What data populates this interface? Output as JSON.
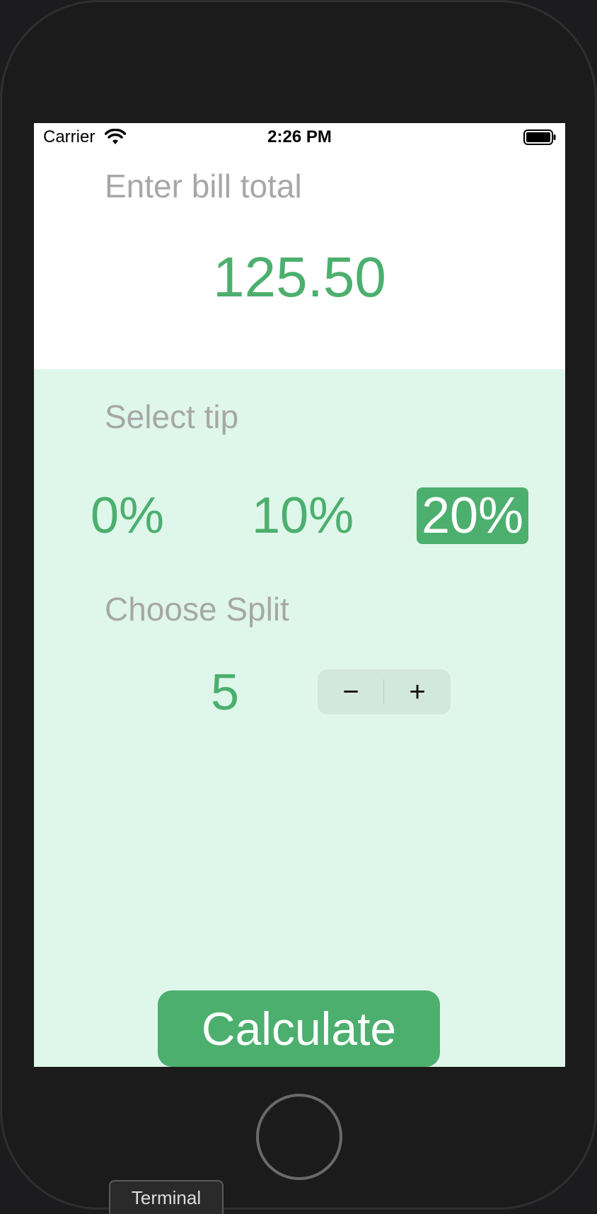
{
  "status_bar": {
    "carrier": "Carrier",
    "time": "2:26 PM"
  },
  "bill": {
    "label": "Enter bill total",
    "value": "125.50"
  },
  "tip": {
    "label": "Select tip",
    "options": [
      "0%",
      "10%",
      "20%"
    ],
    "selected": "20%"
  },
  "split": {
    "label": "Choose Split",
    "value": "5",
    "minus_symbol": "−",
    "plus_symbol": "+"
  },
  "calculate_label": "Calculate",
  "taskbar": {
    "terminal_label": "Terminal"
  },
  "colors": {
    "accent": "#4caf6e",
    "bottom_bg": "#dff7eb",
    "label_gray": "#a7a7a7"
  },
  "icons": [
    "wifi-icon",
    "battery-icon"
  ]
}
